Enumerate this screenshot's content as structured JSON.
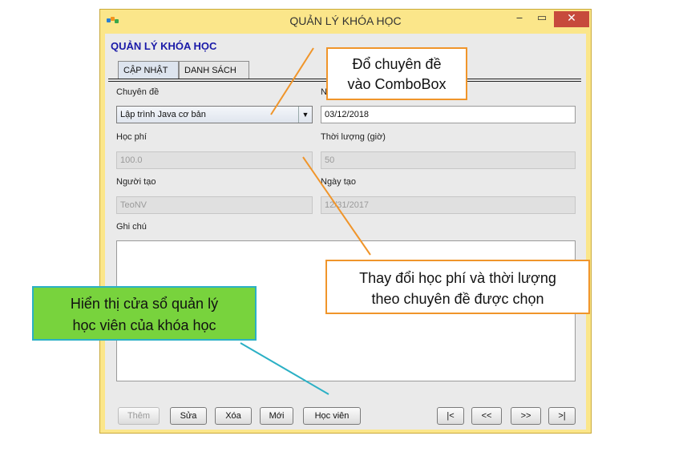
{
  "window": {
    "title": "QUẢN LÝ KHÓA HỌC",
    "controls": {
      "minimize": "‒",
      "maximize": "▭",
      "close": "✕"
    }
  },
  "form": {
    "heading": "QUẢN LÝ KHÓA HỌC",
    "tabs": [
      {
        "label": "CẬP NHẬT",
        "active": true
      },
      {
        "label": "DANH SÁCH",
        "active": false
      }
    ],
    "fields": {
      "chuyen_de": {
        "label": "Chuyên đề",
        "value": "Lập trình Java cơ bản"
      },
      "ngay_khai_giang": {
        "label": "N",
        "value": "03/12/2018"
      },
      "hoc_phi": {
        "label": "Học phí",
        "value": "100.0"
      },
      "thoi_luong": {
        "label": "Thời lượng (giờ)",
        "value": "50"
      },
      "nguoi_tao": {
        "label": "Người tạo",
        "value": "TeoNV"
      },
      "ngay_tao": {
        "label": "Ngày tạo",
        "value": "12/31/2017"
      },
      "ghi_chu": {
        "label": "Ghi chú",
        "value": ""
      }
    },
    "buttons": {
      "them": "Thêm",
      "sua": "Sửa",
      "xoa": "Xóa",
      "moi": "Mới",
      "hoc_vien": "Học viên",
      "first": "|<",
      "prev": "<<",
      "next": ">>",
      "last": ">|"
    }
  },
  "annotations": {
    "combo_note": {
      "line1": "Đổ chuyên đề",
      "line2": "vào ComboBox"
    },
    "fee_note": {
      "line1": "Thay đổi học phí và thời lượng",
      "line2": "theo chuyên đề được chọn"
    },
    "student_note": {
      "line1": "Hiển thị cửa sổ quản lý",
      "line2": "học viên của khóa học"
    }
  },
  "colors": {
    "window_frame": "#fbe68a",
    "heading": "#1a1aa8",
    "callout_border": "#f0952a",
    "green_callout": "#78d33d",
    "cyan_line": "#2bb0c5",
    "close_button": "#c74a3c"
  }
}
